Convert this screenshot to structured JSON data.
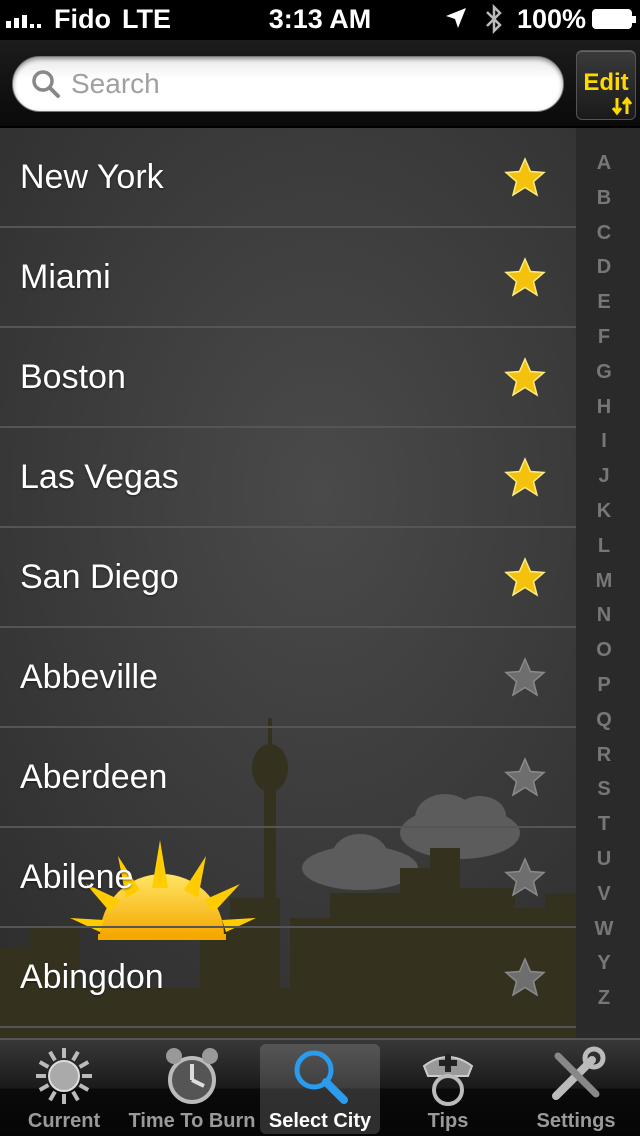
{
  "status_bar": {
    "carrier": "Fido",
    "network": "LTE",
    "time": "3:13 AM",
    "battery": "100%"
  },
  "search": {
    "placeholder": "Search"
  },
  "edit_button": {
    "label": "Edit"
  },
  "cities": [
    {
      "name": "New York",
      "favorite": true
    },
    {
      "name": "Miami",
      "favorite": true
    },
    {
      "name": "Boston",
      "favorite": true
    },
    {
      "name": "Las Vegas",
      "favorite": true
    },
    {
      "name": "San Diego",
      "favorite": true
    },
    {
      "name": "Abbeville",
      "favorite": false
    },
    {
      "name": "Aberdeen",
      "favorite": false
    },
    {
      "name": "Abilene",
      "favorite": false
    },
    {
      "name": "Abingdon",
      "favorite": false
    }
  ],
  "index_letters": [
    "A",
    "B",
    "C",
    "D",
    "E",
    "F",
    "G",
    "H",
    "I",
    "J",
    "K",
    "L",
    "M",
    "N",
    "O",
    "P",
    "Q",
    "R",
    "S",
    "T",
    "U",
    "V",
    "W",
    "Y",
    "Z"
  ],
  "tabs": [
    {
      "label": "Current",
      "icon": "sun-icon",
      "active": false
    },
    {
      "label": "Time To Burn",
      "icon": "alarm-clock-icon",
      "active": false
    },
    {
      "label": "Select City",
      "icon": "magnifier-icon",
      "active": true
    },
    {
      "label": "Tips",
      "icon": "nurse-cap-icon",
      "active": false
    },
    {
      "label": "Settings",
      "icon": "tools-icon",
      "active": false
    }
  ],
  "colors": {
    "accent_yellow": "#ffd800",
    "star_active": "#f4c20d",
    "star_inactive": "#6e6e6e",
    "active_tab_blue": "#2a9cf0"
  }
}
